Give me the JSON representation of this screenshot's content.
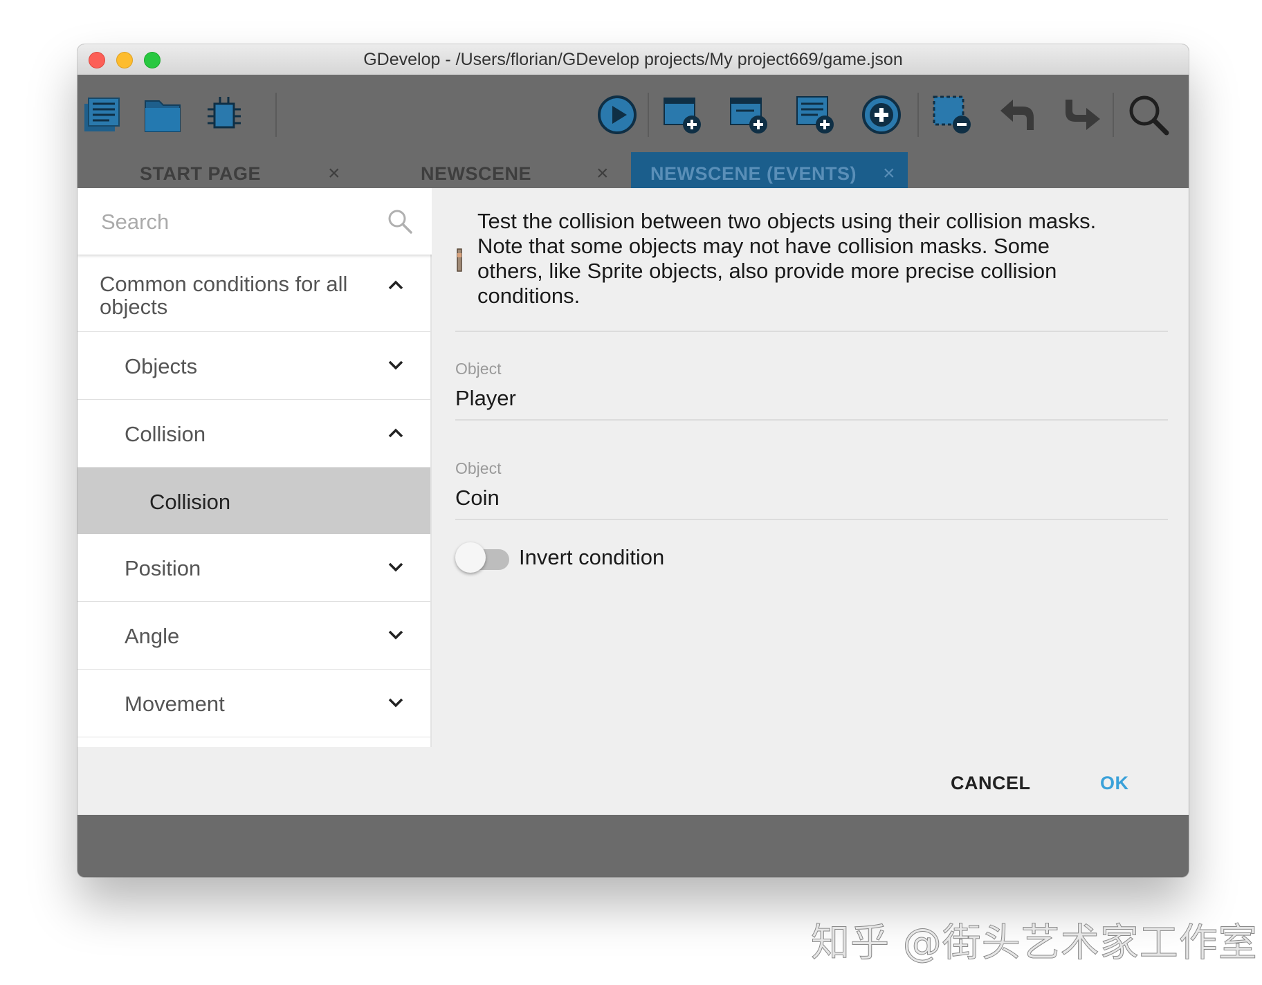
{
  "window": {
    "title": "GDevelop - /Users/florian/GDevelop projects/My project669/game.json"
  },
  "toolbar": {
    "icons": [
      "project-manager-icon",
      "open-project-icon",
      "debugger-icon",
      "preview-play-icon",
      "add-scene-icon",
      "add-external-events-icon",
      "add-external-layout-icon",
      "add-event-icon",
      "delete-selection-icon",
      "undo-icon",
      "redo-icon",
      "search-events-icon"
    ]
  },
  "tabs": [
    {
      "label": "START PAGE",
      "close": "×"
    },
    {
      "label": "NEWSCENE",
      "close": "×"
    },
    {
      "label": "NEWSCENE (EVENTS)",
      "close": "×"
    }
  ],
  "search": {
    "placeholder": "Search"
  },
  "conditions_list": {
    "group_label": "Common conditions for all objects",
    "items": [
      {
        "label": "Objects"
      },
      {
        "label": "Collision"
      },
      {
        "label": "Collision"
      },
      {
        "label": "Position"
      },
      {
        "label": "Angle"
      },
      {
        "label": "Movement"
      }
    ]
  },
  "details": {
    "description": "Test the collision between two objects using their collision masks.\nNote that some objects may not have collision masks. Some\nothers, like Sprite objects, also provide more precise collision\nconditions.",
    "fields": [
      {
        "label": "Object",
        "value": "Player"
      },
      {
        "label": "Object",
        "value": "Coin"
      }
    ],
    "invert_condition": {
      "label": "Invert condition",
      "checked": false
    }
  },
  "actions": {
    "cancel": "CANCEL",
    "ok": "OK"
  },
  "colors": {
    "accent": "#3aa1d9",
    "active_tab": "#1b5e8c",
    "toolbar_bg": "#6b6b6b"
  },
  "watermark": "知乎 @街头艺术家工作室"
}
